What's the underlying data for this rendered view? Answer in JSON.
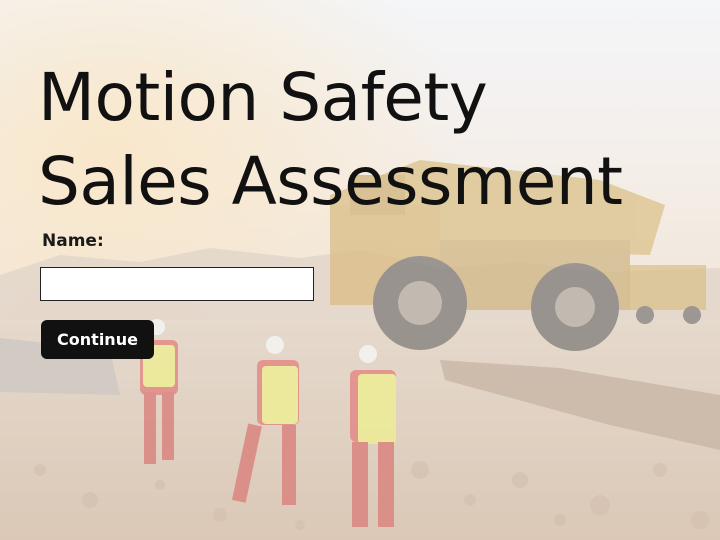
{
  "title": {
    "line1": "Motion Safety",
    "line2": "Sales Assessment"
  },
  "form": {
    "name_label": "Name:",
    "name_value": "",
    "continue_label": "Continue"
  },
  "background": {
    "scene": "mining site with dump trucks and workers in safety gear"
  }
}
